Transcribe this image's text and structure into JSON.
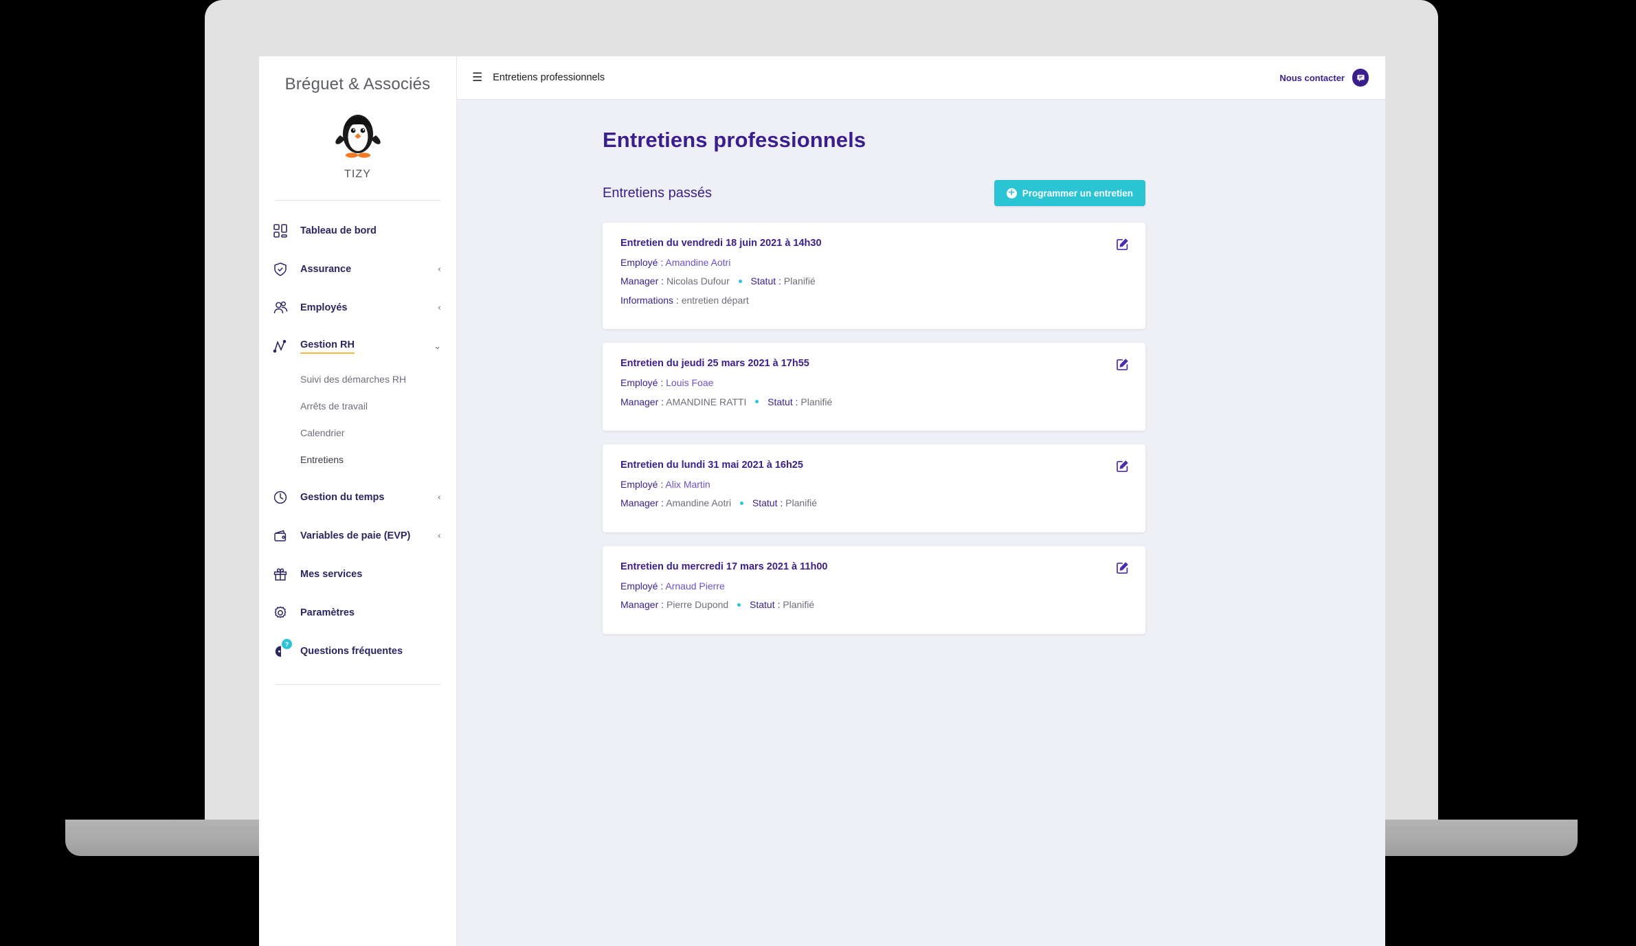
{
  "laptop": {
    "chrome_color": "#e2e2e2",
    "base_color": "#a8a8a8"
  },
  "sidebar": {
    "brand_title": "Bréguet & Associés",
    "brand_logo_icon": "penguin-logo",
    "brand_sub": "TIZY",
    "items": [
      {
        "label": "Tableau de bord",
        "icon": "dashboard-icon",
        "chevron": "",
        "active": false
      },
      {
        "label": "Assurance",
        "icon": "shield-check-icon",
        "chevron": "‹",
        "active": false
      },
      {
        "label": "Employés",
        "icon": "people-icon",
        "chevron": "‹",
        "active": false
      },
      {
        "label": "Gestion RH",
        "icon": "chart-line-icon",
        "chevron": "⌄",
        "active": true
      },
      {
        "label": "Gestion du temps",
        "icon": "clock-icon",
        "chevron": "‹",
        "active": false
      },
      {
        "label": "Variables de paie (EVP)",
        "icon": "wallet-icon",
        "chevron": "‹",
        "active": false
      },
      {
        "label": "Mes services",
        "icon": "gift-icon",
        "chevron": "",
        "active": false
      },
      {
        "label": "Paramètres",
        "icon": "gear-icon",
        "chevron": "",
        "active": false
      },
      {
        "label": "Questions fréquentes",
        "icon": "help-question-icon",
        "chevron": "",
        "active": false,
        "badge": "?"
      }
    ],
    "subitems": [
      {
        "label": "Suivi des démarches RH",
        "current": false
      },
      {
        "label": "Arrêts de travail",
        "current": false
      },
      {
        "label": "Calendrier",
        "current": false
      },
      {
        "label": "Entretiens",
        "current": true
      }
    ],
    "active_underline_color": "#f5b942"
  },
  "topbar": {
    "menu_icon": "hamburger-menu-icon",
    "title": "Entretiens professionnels",
    "contact_label": "Nous contacter",
    "contact_icon": "chat-bubble-icon"
  },
  "main": {
    "page_title": "Entretiens professionnels",
    "section_title": "Entretiens passés",
    "schedule_button_label": "Programmer un entretien",
    "schedule_button_icon": "plus-circle-icon",
    "accent_color": "#2bc4d4",
    "brand_purple": "#3b1e8e",
    "labels": {
      "employee": "Employé :",
      "manager": "Manager :",
      "status": "Statut :",
      "info": "Informations :"
    },
    "cards": [
      {
        "title": "Entretien du vendredi 18 juin 2021 à 14h30",
        "employee": "Amandine Aotri",
        "manager": "Nicolas Dufour",
        "status": "Planifié",
        "info": "entretien départ",
        "edit_icon": "edit-pencil-icon"
      },
      {
        "title": "Entretien du jeudi 25 mars 2021 à 17h55",
        "employee": "Louis Foae",
        "manager": "AMANDINE RATTI",
        "status": "Planifié",
        "info": "",
        "edit_icon": "edit-pencil-icon"
      },
      {
        "title": "Entretien du lundi 31 mai 2021 à 16h25",
        "employee": "Alix Martin",
        "manager": "Amandine Aotri",
        "status": "Planifié",
        "info": "",
        "edit_icon": "edit-pencil-icon"
      },
      {
        "title": "Entretien du mercredi 17 mars 2021 à 11h00",
        "employee": "Arnaud Pierre",
        "manager": "Pierre Dupond",
        "status": "Planifié",
        "info": "",
        "edit_icon": "edit-pencil-icon"
      }
    ]
  }
}
